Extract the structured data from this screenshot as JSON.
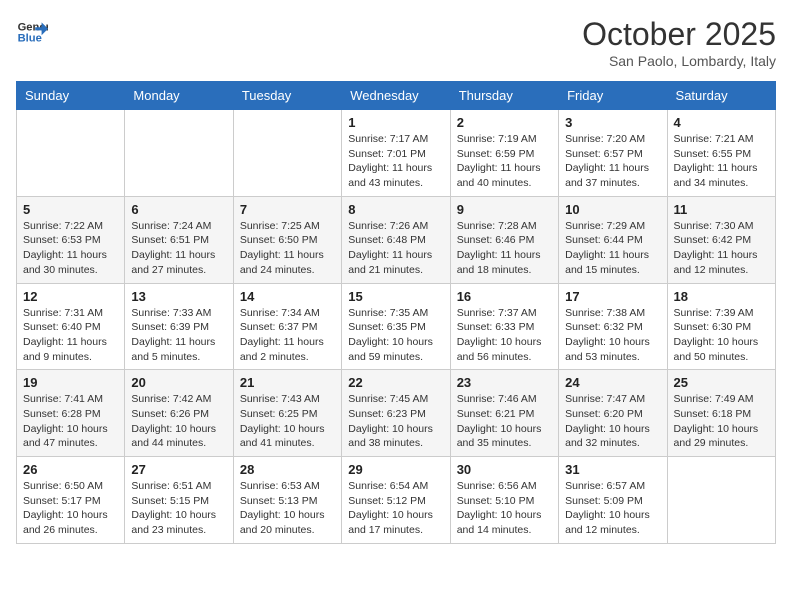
{
  "header": {
    "logo_line1": "General",
    "logo_line2": "Blue",
    "month_title": "October 2025",
    "location": "San Paolo, Lombardy, Italy"
  },
  "weekdays": [
    "Sunday",
    "Monday",
    "Tuesday",
    "Wednesday",
    "Thursday",
    "Friday",
    "Saturday"
  ],
  "weeks": [
    [
      {
        "day": "",
        "sunrise": "",
        "sunset": "",
        "daylight": ""
      },
      {
        "day": "",
        "sunrise": "",
        "sunset": "",
        "daylight": ""
      },
      {
        "day": "",
        "sunrise": "",
        "sunset": "",
        "daylight": ""
      },
      {
        "day": "1",
        "sunrise": "Sunrise: 7:17 AM",
        "sunset": "Sunset: 7:01 PM",
        "daylight": "Daylight: 11 hours and 43 minutes."
      },
      {
        "day": "2",
        "sunrise": "Sunrise: 7:19 AM",
        "sunset": "Sunset: 6:59 PM",
        "daylight": "Daylight: 11 hours and 40 minutes."
      },
      {
        "day": "3",
        "sunrise": "Sunrise: 7:20 AM",
        "sunset": "Sunset: 6:57 PM",
        "daylight": "Daylight: 11 hours and 37 minutes."
      },
      {
        "day": "4",
        "sunrise": "Sunrise: 7:21 AM",
        "sunset": "Sunset: 6:55 PM",
        "daylight": "Daylight: 11 hours and 34 minutes."
      }
    ],
    [
      {
        "day": "5",
        "sunrise": "Sunrise: 7:22 AM",
        "sunset": "Sunset: 6:53 PM",
        "daylight": "Daylight: 11 hours and 30 minutes."
      },
      {
        "day": "6",
        "sunrise": "Sunrise: 7:24 AM",
        "sunset": "Sunset: 6:51 PM",
        "daylight": "Daylight: 11 hours and 27 minutes."
      },
      {
        "day": "7",
        "sunrise": "Sunrise: 7:25 AM",
        "sunset": "Sunset: 6:50 PM",
        "daylight": "Daylight: 11 hours and 24 minutes."
      },
      {
        "day": "8",
        "sunrise": "Sunrise: 7:26 AM",
        "sunset": "Sunset: 6:48 PM",
        "daylight": "Daylight: 11 hours and 21 minutes."
      },
      {
        "day": "9",
        "sunrise": "Sunrise: 7:28 AM",
        "sunset": "Sunset: 6:46 PM",
        "daylight": "Daylight: 11 hours and 18 minutes."
      },
      {
        "day": "10",
        "sunrise": "Sunrise: 7:29 AM",
        "sunset": "Sunset: 6:44 PM",
        "daylight": "Daylight: 11 hours and 15 minutes."
      },
      {
        "day": "11",
        "sunrise": "Sunrise: 7:30 AM",
        "sunset": "Sunset: 6:42 PM",
        "daylight": "Daylight: 11 hours and 12 minutes."
      }
    ],
    [
      {
        "day": "12",
        "sunrise": "Sunrise: 7:31 AM",
        "sunset": "Sunset: 6:40 PM",
        "daylight": "Daylight: 11 hours and 9 minutes."
      },
      {
        "day": "13",
        "sunrise": "Sunrise: 7:33 AM",
        "sunset": "Sunset: 6:39 PM",
        "daylight": "Daylight: 11 hours and 5 minutes."
      },
      {
        "day": "14",
        "sunrise": "Sunrise: 7:34 AM",
        "sunset": "Sunset: 6:37 PM",
        "daylight": "Daylight: 11 hours and 2 minutes."
      },
      {
        "day": "15",
        "sunrise": "Sunrise: 7:35 AM",
        "sunset": "Sunset: 6:35 PM",
        "daylight": "Daylight: 10 hours and 59 minutes."
      },
      {
        "day": "16",
        "sunrise": "Sunrise: 7:37 AM",
        "sunset": "Sunset: 6:33 PM",
        "daylight": "Daylight: 10 hours and 56 minutes."
      },
      {
        "day": "17",
        "sunrise": "Sunrise: 7:38 AM",
        "sunset": "Sunset: 6:32 PM",
        "daylight": "Daylight: 10 hours and 53 minutes."
      },
      {
        "day": "18",
        "sunrise": "Sunrise: 7:39 AM",
        "sunset": "Sunset: 6:30 PM",
        "daylight": "Daylight: 10 hours and 50 minutes."
      }
    ],
    [
      {
        "day": "19",
        "sunrise": "Sunrise: 7:41 AM",
        "sunset": "Sunset: 6:28 PM",
        "daylight": "Daylight: 10 hours and 47 minutes."
      },
      {
        "day": "20",
        "sunrise": "Sunrise: 7:42 AM",
        "sunset": "Sunset: 6:26 PM",
        "daylight": "Daylight: 10 hours and 44 minutes."
      },
      {
        "day": "21",
        "sunrise": "Sunrise: 7:43 AM",
        "sunset": "Sunset: 6:25 PM",
        "daylight": "Daylight: 10 hours and 41 minutes."
      },
      {
        "day": "22",
        "sunrise": "Sunrise: 7:45 AM",
        "sunset": "Sunset: 6:23 PM",
        "daylight": "Daylight: 10 hours and 38 minutes."
      },
      {
        "day": "23",
        "sunrise": "Sunrise: 7:46 AM",
        "sunset": "Sunset: 6:21 PM",
        "daylight": "Daylight: 10 hours and 35 minutes."
      },
      {
        "day": "24",
        "sunrise": "Sunrise: 7:47 AM",
        "sunset": "Sunset: 6:20 PM",
        "daylight": "Daylight: 10 hours and 32 minutes."
      },
      {
        "day": "25",
        "sunrise": "Sunrise: 7:49 AM",
        "sunset": "Sunset: 6:18 PM",
        "daylight": "Daylight: 10 hours and 29 minutes."
      }
    ],
    [
      {
        "day": "26",
        "sunrise": "Sunrise: 6:50 AM",
        "sunset": "Sunset: 5:17 PM",
        "daylight": "Daylight: 10 hours and 26 minutes."
      },
      {
        "day": "27",
        "sunrise": "Sunrise: 6:51 AM",
        "sunset": "Sunset: 5:15 PM",
        "daylight": "Daylight: 10 hours and 23 minutes."
      },
      {
        "day": "28",
        "sunrise": "Sunrise: 6:53 AM",
        "sunset": "Sunset: 5:13 PM",
        "daylight": "Daylight: 10 hours and 20 minutes."
      },
      {
        "day": "29",
        "sunrise": "Sunrise: 6:54 AM",
        "sunset": "Sunset: 5:12 PM",
        "daylight": "Daylight: 10 hours and 17 minutes."
      },
      {
        "day": "30",
        "sunrise": "Sunrise: 6:56 AM",
        "sunset": "Sunset: 5:10 PM",
        "daylight": "Daylight: 10 hours and 14 minutes."
      },
      {
        "day": "31",
        "sunrise": "Sunrise: 6:57 AM",
        "sunset": "Sunset: 5:09 PM",
        "daylight": "Daylight: 10 hours and 12 minutes."
      },
      {
        "day": "",
        "sunrise": "",
        "sunset": "",
        "daylight": ""
      }
    ]
  ]
}
